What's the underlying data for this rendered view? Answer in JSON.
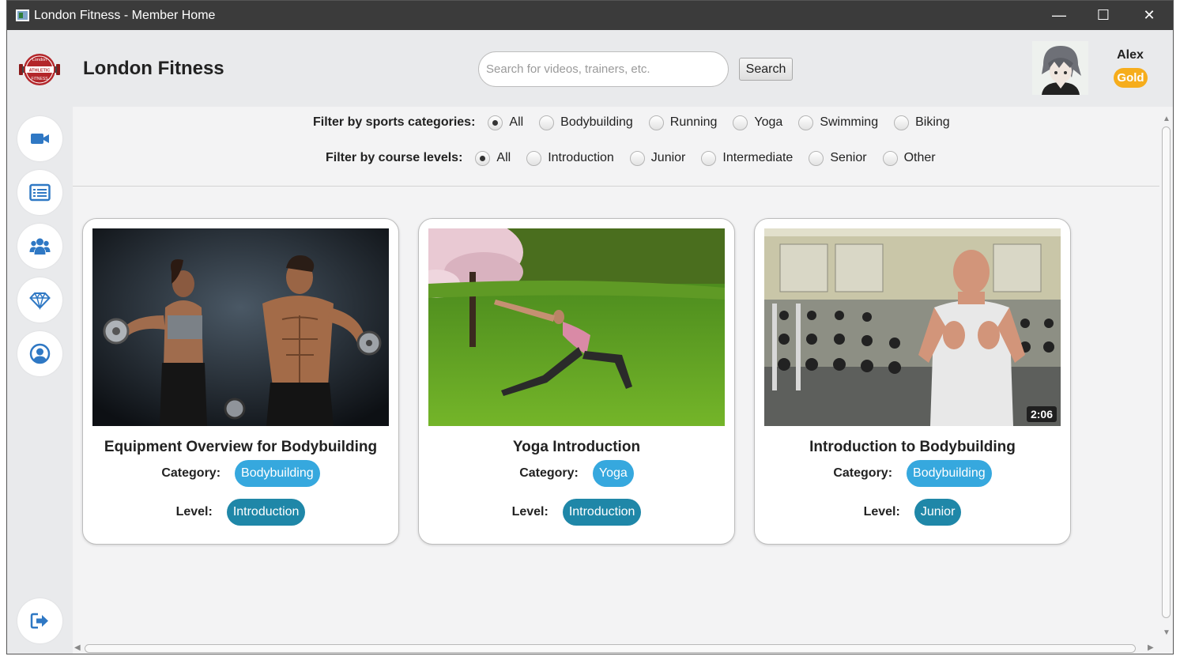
{
  "window": {
    "title": "London Fitness - Member Home",
    "minimize": "—",
    "maximize": "☐",
    "close": "✕"
  },
  "header": {
    "brand": "London Fitness",
    "logo_text": [
      "London",
      "ATHLETIC",
      "FITNESS"
    ],
    "search_placeholder": "Search for videos, trainers, etc.",
    "search_value": "",
    "search_button": "Search",
    "user": {
      "name": "Alex",
      "tier": "Gold"
    }
  },
  "sidebar": {
    "items": [
      {
        "icon": "video-camera-icon"
      },
      {
        "icon": "list-icon"
      },
      {
        "icon": "users-icon"
      },
      {
        "icon": "diamond-icon"
      },
      {
        "icon": "user-circle-icon"
      }
    ],
    "logout_icon": "sign-out-icon"
  },
  "filters": {
    "category_label": "Filter by sports categories:",
    "categories": [
      "All",
      "Bodybuilding",
      "Running",
      "Yoga",
      "Swimming",
      "Biking"
    ],
    "category_selected": "All",
    "level_label": "Filter by course levels:",
    "levels": [
      "All",
      "Introduction",
      "Junior",
      "Intermediate",
      "Senior",
      "Other"
    ],
    "level_selected": "All"
  },
  "cards": [
    {
      "title": "Equipment Overview for Bodybuilding",
      "category_label": "Category:",
      "category": "Bodybuilding",
      "level_label": "Level:",
      "level": "Introduction",
      "duration": ""
    },
    {
      "title": "Yoga Introduction",
      "category_label": "Category:",
      "category": "Yoga",
      "level_label": "Level:",
      "level": "Introduction",
      "duration": ""
    },
    {
      "title": "Introduction to Bodybuilding",
      "category_label": "Category:",
      "category": "Bodybuilding",
      "level_label": "Level:",
      "level": "Junior",
      "duration": "2:06"
    }
  ],
  "colors": {
    "category_pill": "#36a8de",
    "level_pill": "#1f87a8",
    "tier_badge": "#f6ad1c",
    "nav_icon": "#2f78c4"
  }
}
